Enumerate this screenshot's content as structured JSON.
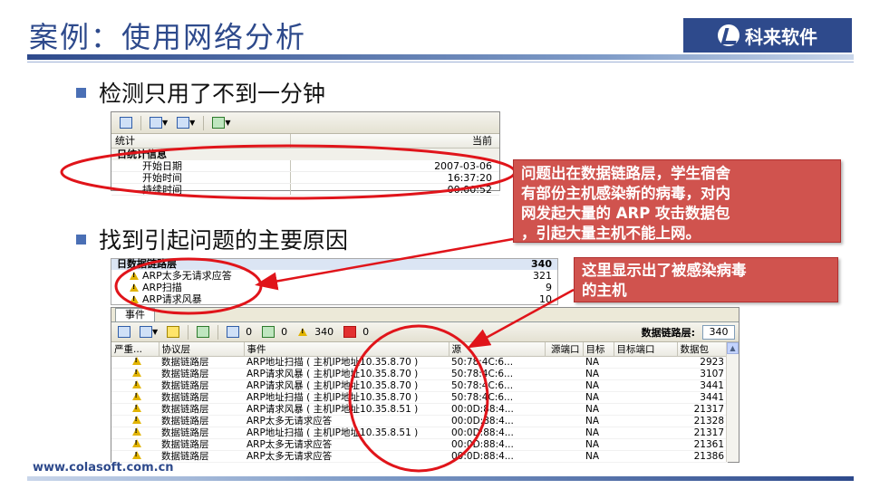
{
  "slide": {
    "title": "案例：使用网络分析",
    "logo": "科来软件",
    "footer_url": "www.colasoft.com.cn",
    "bullets": [
      "检测只用了不到一分钟",
      "找到引起问题的主要原因"
    ]
  },
  "stats_panel": {
    "columns": [
      "统计",
      "当前"
    ],
    "group": "日统计信息",
    "rows": [
      {
        "key": "开始日期",
        "value": "2007-03-06"
      },
      {
        "key": "开始时间",
        "value": "16:37:20"
      },
      {
        "key": "持续时间",
        "value": "00:00:52"
      }
    ]
  },
  "causes_panel": {
    "header": {
      "name": "日数据链路层",
      "count": "340"
    },
    "rows": [
      {
        "name": "ARP太多无请求应答",
        "count": "321"
      },
      {
        "name": "ARP扫描",
        "count": "9"
      },
      {
        "name": "ARP请求风暴",
        "count": "10"
      }
    ]
  },
  "events_window": {
    "tab": "事件",
    "counts": {
      "info": "0",
      "note": "0",
      "warning": "340",
      "error": "0"
    },
    "layer_label": "数据链路层:",
    "layer_value": "340",
    "columns": [
      "严重...",
      "协议层",
      "事件",
      "源",
      "源端口",
      "目标",
      "目标端口",
      "数据包"
    ],
    "rows": [
      {
        "layer": "数据链路层",
        "event": "ARP地址扫描 ( 主机IP地址10.35.8.70 )",
        "src": "50:78:4C:6...",
        "src_port": "",
        "dst": "NA",
        "dst_port": "",
        "packets": "2923"
      },
      {
        "layer": "数据链路层",
        "event": "ARP请求风暴 ( 主机IP地址10.35.8.70 )",
        "src": "50:78:4C:6...",
        "src_port": "",
        "dst": "NA",
        "dst_port": "",
        "packets": "3107"
      },
      {
        "layer": "数据链路层",
        "event": "ARP请求风暴 ( 主机IP地址10.35.8.70 )",
        "src": "50:78:4C:6...",
        "src_port": "",
        "dst": "NA",
        "dst_port": "",
        "packets": "3441"
      },
      {
        "layer": "数据链路层",
        "event": "ARP地址扫描 ( 主机IP地址10.35.8.70 )",
        "src": "50:78:4C:6...",
        "src_port": "",
        "dst": "NA",
        "dst_port": "",
        "packets": "3441"
      },
      {
        "layer": "数据链路层",
        "event": "ARP请求风暴 ( 主机IP地址10.35.8.51 )",
        "src": "00:0D:88:4...",
        "src_port": "",
        "dst": "NA",
        "dst_port": "",
        "packets": "21317"
      },
      {
        "layer": "数据链路层",
        "event": "ARP太多无请求应答",
        "src": "00:0D:88:4...",
        "src_port": "",
        "dst": "NA",
        "dst_port": "",
        "packets": "21328"
      },
      {
        "layer": "数据链路层",
        "event": "ARP地址扫描 ( 主机IP地址10.35.8.51 )",
        "src": "00:0D:88:4...",
        "src_port": "",
        "dst": "NA",
        "dst_port": "",
        "packets": "21317"
      },
      {
        "layer": "数据链路层",
        "event": "ARP太多无请求应答",
        "src": "00:0D:88:4...",
        "src_port": "",
        "dst": "NA",
        "dst_port": "",
        "packets": "21361"
      },
      {
        "layer": "数据链路层",
        "event": "ARP太多无请求应答",
        "src": "00:0D:88:4...",
        "src_port": "",
        "dst": "NA",
        "dst_port": "",
        "packets": "21386"
      }
    ]
  },
  "callouts": {
    "first": [
      "问题出在数据链路层，学生宿舍",
      "有部份主机感染新的病毒，对内",
      "网发起大量的 ARP 攻击数据包",
      "，引起大量主机不能上网。"
    ],
    "second": [
      "这里显示出了被感染病毒",
      "的主机"
    ]
  },
  "colors": {
    "title_blue": "#2e4a8c",
    "annotation_red": "#e0141a",
    "callout_fill": "#d0534e"
  }
}
